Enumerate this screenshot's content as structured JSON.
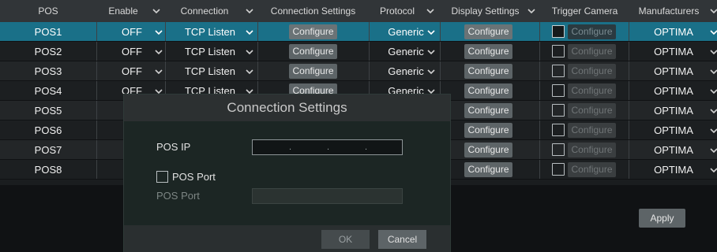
{
  "header": {
    "pos": "POS",
    "enable": "Enable",
    "connection": "Connection",
    "connection_settings": "Connection Settings",
    "protocol": "Protocol",
    "display_settings": "Display Settings",
    "trigger_camera": "Trigger Camera",
    "manufacturers": "Manufacturers"
  },
  "rows": [
    {
      "pos": "POS1",
      "enable": "OFF",
      "connection": "TCP Listen",
      "conn_btn": "Configure",
      "protocol": "Generic",
      "disp_btn": "Configure",
      "trig_btn": "Configure",
      "manufacturer": "OPTIMA"
    },
    {
      "pos": "POS2",
      "enable": "OFF",
      "connection": "TCP Listen",
      "conn_btn": "Configure",
      "protocol": "Generic",
      "disp_btn": "Configure",
      "trig_btn": "Configure",
      "manufacturer": "OPTIMA"
    },
    {
      "pos": "POS3",
      "enable": "OFF",
      "connection": "TCP Listen",
      "conn_btn": "Configure",
      "protocol": "Generic",
      "disp_btn": "Configure",
      "trig_btn": "Configure",
      "manufacturer": "OPTIMA"
    },
    {
      "pos": "POS4",
      "enable": "OFF",
      "connection": "TCP Listen",
      "conn_btn": "Configure",
      "protocol": "Generic",
      "disp_btn": "Configure",
      "trig_btn": "Configure",
      "manufacturer": "OPTIMA"
    },
    {
      "pos": "POS5",
      "enable": "",
      "connection": "",
      "conn_btn": "",
      "protocol": "",
      "disp_btn": "Configure",
      "trig_btn": "Configure",
      "manufacturer": "OPTIMA"
    },
    {
      "pos": "POS6",
      "enable": "",
      "connection": "",
      "conn_btn": "",
      "protocol": "",
      "disp_btn": "Configure",
      "trig_btn": "Configure",
      "manufacturer": "OPTIMA"
    },
    {
      "pos": "POS7",
      "enable": "",
      "connection": "",
      "conn_btn": "",
      "protocol": "",
      "disp_btn": "Configure",
      "trig_btn": "Configure",
      "manufacturer": "OPTIMA"
    },
    {
      "pos": "POS8",
      "enable": "",
      "connection": "",
      "conn_btn": "",
      "protocol": "",
      "disp_btn": "Configure",
      "trig_btn": "Configure",
      "manufacturer": "OPTIMA"
    }
  ],
  "apply_label": "Apply",
  "dialog": {
    "title": "Connection Settings",
    "pos_ip_label": "POS IP",
    "ip_separators": [
      ".",
      ".",
      "."
    ],
    "pos_port_checkbox_label": "POS Port",
    "pos_port_field_label": "POS Port",
    "ok_label": "OK",
    "cancel_label": "Cancel"
  },
  "colors": {
    "selected_row": "#1a7088",
    "header_bg": "#313538",
    "button_bg": "#5d6467"
  }
}
